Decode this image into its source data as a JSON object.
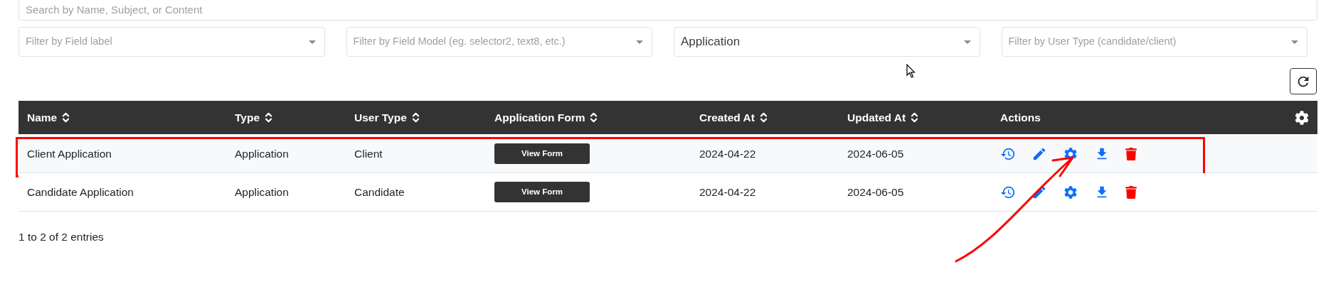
{
  "search": {
    "placeholder": "Search by Name, Subject, or Content"
  },
  "filters": [
    {
      "placeholder": "Filter by Field label"
    },
    {
      "placeholder": "Filter by Field Model (eg. selector2, text8, etc.)"
    },
    {
      "value": "Application"
    },
    {
      "placeholder": "Filter by User Type (candidate/client)"
    }
  ],
  "table": {
    "columns": [
      {
        "label": "Name",
        "sortable": true
      },
      {
        "label": "Type",
        "sortable": true
      },
      {
        "label": "User Type",
        "sortable": true
      },
      {
        "label": "Application Form",
        "sortable": true
      },
      {
        "label": "Created At",
        "sortable": true
      },
      {
        "label": "Updated At",
        "sortable": true
      },
      {
        "label": "Actions",
        "sortable": false
      }
    ],
    "rows": [
      {
        "highlighted": true,
        "name": "Client Application",
        "type": "Application",
        "user_type": "Client",
        "form_button": "View Form",
        "created_at": "2024-04-22",
        "updated_at": "2024-06-05",
        "actions": [
          {
            "kind": "history"
          },
          {
            "kind": "edit"
          },
          {
            "kind": "settings"
          },
          {
            "kind": "download"
          },
          {
            "kind": "delete"
          }
        ]
      },
      {
        "highlighted": false,
        "name": "Candidate Application",
        "type": "Application",
        "user_type": "Candidate",
        "form_button": "View Form",
        "created_at": "2024-04-22",
        "updated_at": "2024-06-05",
        "actions": [
          {
            "kind": "history"
          },
          {
            "kind": "edit"
          },
          {
            "kind": "settings"
          },
          {
            "kind": "download"
          },
          {
            "kind": "delete"
          }
        ]
      }
    ]
  },
  "entries": "1 to 2 of 2 entries"
}
